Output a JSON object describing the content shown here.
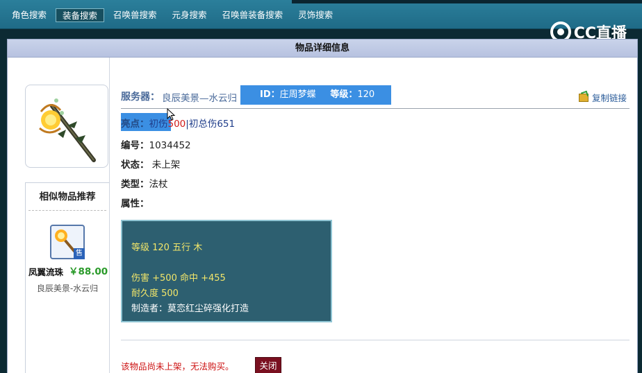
{
  "nav": {
    "items": [
      {
        "label": "角色搜索",
        "active": false
      },
      {
        "label": "装备搜索",
        "active": true
      },
      {
        "label": "召唤兽搜索",
        "active": false
      },
      {
        "label": "元身搜索",
        "active": false
      },
      {
        "label": "召唤兽装备搜索",
        "active": false
      },
      {
        "label": "灵饰搜索",
        "active": false
      }
    ]
  },
  "watermark": {
    "text": "CC直播"
  },
  "panel": {
    "title": "物品详细信息"
  },
  "item": {
    "server_label": "服务器：",
    "server_value": "良辰美景—水云归",
    "id_label": "ID：",
    "id_value": "庄周梦蝶",
    "level_label": "等级：",
    "level_value": "120",
    "copy_link": "复制链接",
    "highlight_label": "亮点：",
    "highlight_prefix": "初伤",
    "highlight_red": "500",
    "highlight_sep": "|",
    "highlight_rest": "初总伤651",
    "number_label": "编号：",
    "number_value": "1034452",
    "status_label": "状态：",
    "status_value": "未上架",
    "type_label": "类型：",
    "type_value": "法杖",
    "props_label": "属性："
  },
  "props": {
    "line1": "等级 120 五行 木",
    "line2": "伤害 +500 命中 +455",
    "line3": "耐久度 500",
    "line4": "制造者：莫恋红尘碎强化打造"
  },
  "similar": {
    "title": "相似物品推荐",
    "items": [
      {
        "name": "凤翼流珠",
        "price": "￥88.00",
        "server": "良辰美景-水云归",
        "badge": "售"
      }
    ]
  },
  "notice": "该物品尚未上架，无法购买。",
  "close_label": "关闭",
  "colors": {
    "accent": "#3b8fe3",
    "nav": "#2b7f9b",
    "prop_bg": "#2d5f70",
    "close": "#7a1020"
  }
}
